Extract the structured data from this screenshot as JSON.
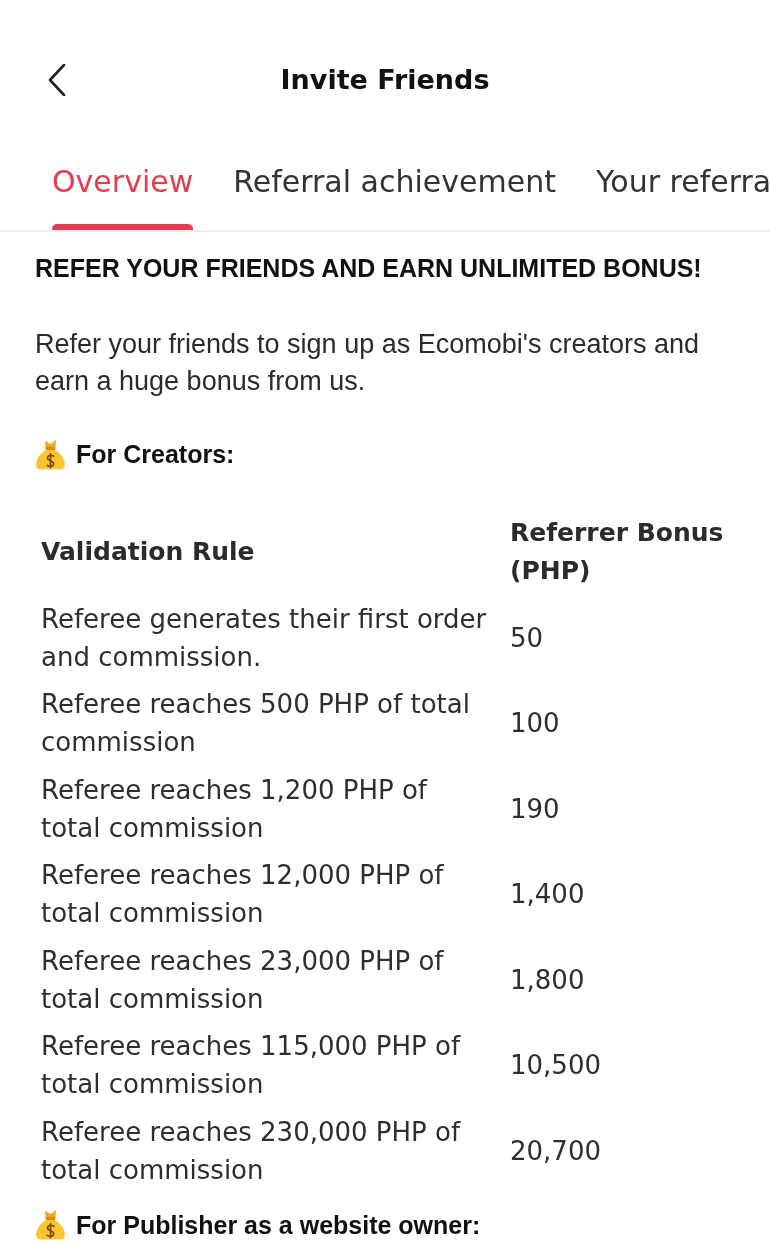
{
  "header": {
    "title": "Invite Friends"
  },
  "tabs": [
    {
      "label": "Overview",
      "selected": true
    },
    {
      "label": "Referral achievement",
      "selected": false
    },
    {
      "label": "Your referra",
      "selected": false
    }
  ],
  "content": {
    "heading": "REFER YOUR FRIENDS AND EARN UNLIMITED BONUS!",
    "intro": "Refer your friends to sign up as Ecomobi's creators and earn a huge bonus from us.",
    "sections": [
      {
        "title": "For Creators:",
        "table": {
          "columns": [
            "Validation Rule",
            "Referrer Bonus (PHP)"
          ],
          "rows": [
            [
              "Referee generates their first order and commission.",
              "50"
            ],
            [
              "Referee reaches 500 PHP of total commission",
              "100"
            ],
            [
              "Referee reaches 1,200 PHP of total commission",
              "190"
            ],
            [
              "Referee reaches 12,000 PHP of total commission",
              "1,400"
            ],
            [
              "Referee reaches 23,000 PHP of total commission",
              "1,800"
            ],
            [
              "Referee reaches 115,000 PHP of total commission",
              "10,500"
            ],
            [
              "Referee reaches 230,000 PHP of total commission",
              "20,700"
            ]
          ]
        }
      },
      {
        "title": "For Publisher as a website owner:"
      }
    ]
  }
}
